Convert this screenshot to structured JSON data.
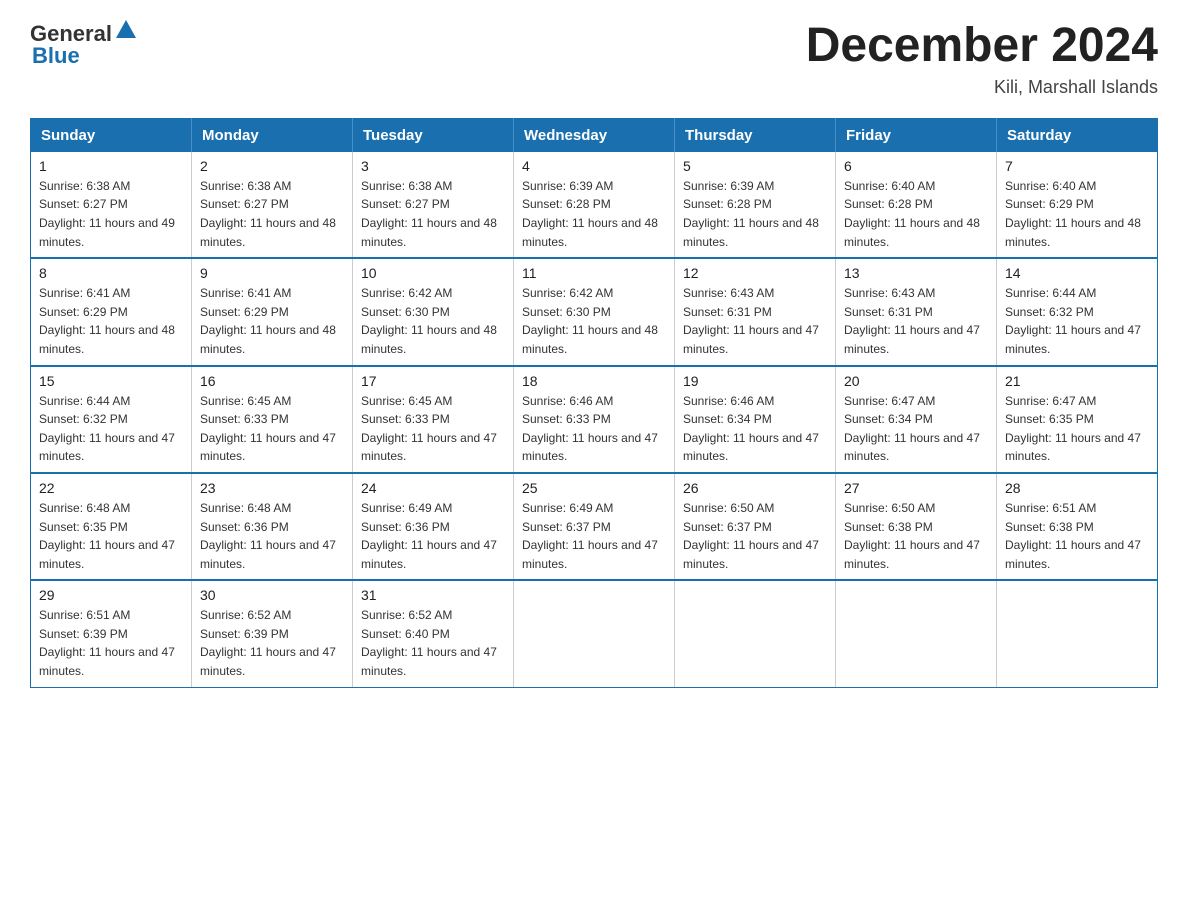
{
  "logo": {
    "general": "General",
    "blue": "Blue"
  },
  "title": "December 2024",
  "location": "Kili, Marshall Islands",
  "days_of_week": [
    "Sunday",
    "Monday",
    "Tuesday",
    "Wednesday",
    "Thursday",
    "Friday",
    "Saturday"
  ],
  "weeks": [
    [
      {
        "day": "1",
        "sunrise": "6:38 AM",
        "sunset": "6:27 PM",
        "daylight": "11 hours and 49 minutes."
      },
      {
        "day": "2",
        "sunrise": "6:38 AM",
        "sunset": "6:27 PM",
        "daylight": "11 hours and 48 minutes."
      },
      {
        "day": "3",
        "sunrise": "6:38 AM",
        "sunset": "6:27 PM",
        "daylight": "11 hours and 48 minutes."
      },
      {
        "day": "4",
        "sunrise": "6:39 AM",
        "sunset": "6:28 PM",
        "daylight": "11 hours and 48 minutes."
      },
      {
        "day": "5",
        "sunrise": "6:39 AM",
        "sunset": "6:28 PM",
        "daylight": "11 hours and 48 minutes."
      },
      {
        "day": "6",
        "sunrise": "6:40 AM",
        "sunset": "6:28 PM",
        "daylight": "11 hours and 48 minutes."
      },
      {
        "day": "7",
        "sunrise": "6:40 AM",
        "sunset": "6:29 PM",
        "daylight": "11 hours and 48 minutes."
      }
    ],
    [
      {
        "day": "8",
        "sunrise": "6:41 AM",
        "sunset": "6:29 PM",
        "daylight": "11 hours and 48 minutes."
      },
      {
        "day": "9",
        "sunrise": "6:41 AM",
        "sunset": "6:29 PM",
        "daylight": "11 hours and 48 minutes."
      },
      {
        "day": "10",
        "sunrise": "6:42 AM",
        "sunset": "6:30 PM",
        "daylight": "11 hours and 48 minutes."
      },
      {
        "day": "11",
        "sunrise": "6:42 AM",
        "sunset": "6:30 PM",
        "daylight": "11 hours and 48 minutes."
      },
      {
        "day": "12",
        "sunrise": "6:43 AM",
        "sunset": "6:31 PM",
        "daylight": "11 hours and 47 minutes."
      },
      {
        "day": "13",
        "sunrise": "6:43 AM",
        "sunset": "6:31 PM",
        "daylight": "11 hours and 47 minutes."
      },
      {
        "day": "14",
        "sunrise": "6:44 AM",
        "sunset": "6:32 PM",
        "daylight": "11 hours and 47 minutes."
      }
    ],
    [
      {
        "day": "15",
        "sunrise": "6:44 AM",
        "sunset": "6:32 PM",
        "daylight": "11 hours and 47 minutes."
      },
      {
        "day": "16",
        "sunrise": "6:45 AM",
        "sunset": "6:33 PM",
        "daylight": "11 hours and 47 minutes."
      },
      {
        "day": "17",
        "sunrise": "6:45 AM",
        "sunset": "6:33 PM",
        "daylight": "11 hours and 47 minutes."
      },
      {
        "day": "18",
        "sunrise": "6:46 AM",
        "sunset": "6:33 PM",
        "daylight": "11 hours and 47 minutes."
      },
      {
        "day": "19",
        "sunrise": "6:46 AM",
        "sunset": "6:34 PM",
        "daylight": "11 hours and 47 minutes."
      },
      {
        "day": "20",
        "sunrise": "6:47 AM",
        "sunset": "6:34 PM",
        "daylight": "11 hours and 47 minutes."
      },
      {
        "day": "21",
        "sunrise": "6:47 AM",
        "sunset": "6:35 PM",
        "daylight": "11 hours and 47 minutes."
      }
    ],
    [
      {
        "day": "22",
        "sunrise": "6:48 AM",
        "sunset": "6:35 PM",
        "daylight": "11 hours and 47 minutes."
      },
      {
        "day": "23",
        "sunrise": "6:48 AM",
        "sunset": "6:36 PM",
        "daylight": "11 hours and 47 minutes."
      },
      {
        "day": "24",
        "sunrise": "6:49 AM",
        "sunset": "6:36 PM",
        "daylight": "11 hours and 47 minutes."
      },
      {
        "day": "25",
        "sunrise": "6:49 AM",
        "sunset": "6:37 PM",
        "daylight": "11 hours and 47 minutes."
      },
      {
        "day": "26",
        "sunrise": "6:50 AM",
        "sunset": "6:37 PM",
        "daylight": "11 hours and 47 minutes."
      },
      {
        "day": "27",
        "sunrise": "6:50 AM",
        "sunset": "6:38 PM",
        "daylight": "11 hours and 47 minutes."
      },
      {
        "day": "28",
        "sunrise": "6:51 AM",
        "sunset": "6:38 PM",
        "daylight": "11 hours and 47 minutes."
      }
    ],
    [
      {
        "day": "29",
        "sunrise": "6:51 AM",
        "sunset": "6:39 PM",
        "daylight": "11 hours and 47 minutes."
      },
      {
        "day": "30",
        "sunrise": "6:52 AM",
        "sunset": "6:39 PM",
        "daylight": "11 hours and 47 minutes."
      },
      {
        "day": "31",
        "sunrise": "6:52 AM",
        "sunset": "6:40 PM",
        "daylight": "11 hours and 47 minutes."
      },
      null,
      null,
      null,
      null
    ]
  ]
}
